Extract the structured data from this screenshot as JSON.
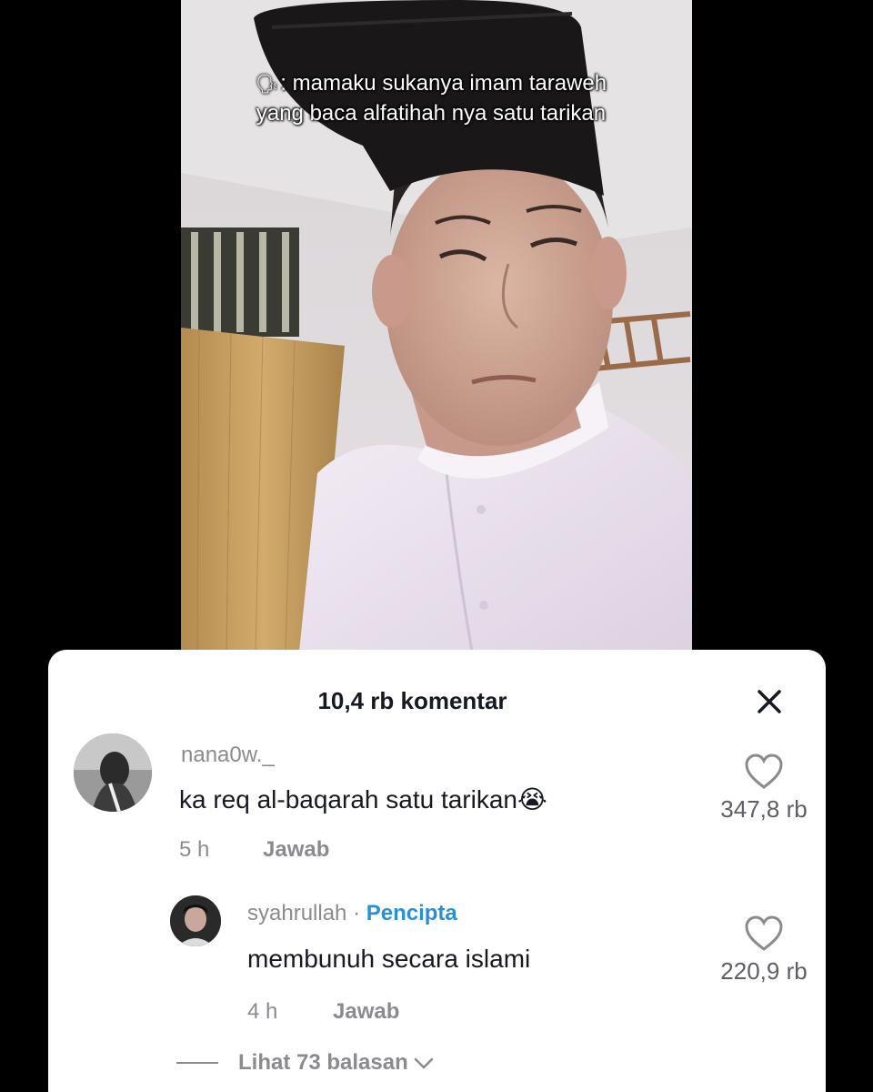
{
  "video": {
    "caption_icon": "speaking-head-icon",
    "caption": ": mamaku sukanya imam taraweh yang baca alfatihah nya satu tarikan"
  },
  "comments_panel": {
    "title": "10,4 rb komentar",
    "close_icon": "close-icon",
    "comments": [
      {
        "username": "nana0w._",
        "text": "ka req al-baqarah satu tarikan",
        "emoji": "😭",
        "time": "5 h",
        "reply_label": "Jawab",
        "likes": "347,8 rb"
      }
    ],
    "replies": [
      {
        "username": "syahrullah",
        "separator": " · ",
        "creator_badge": "Pencipta",
        "text": "membunuh secara islami",
        "time": "4 h",
        "reply_label": "Jawab",
        "likes": "220,9 rb"
      }
    ],
    "view_replies": "Lihat 73 balasan"
  },
  "colors": {
    "accent_creator": "#2b8fd8",
    "text_primary": "#161823",
    "text_secondary": "#8a8b91"
  }
}
